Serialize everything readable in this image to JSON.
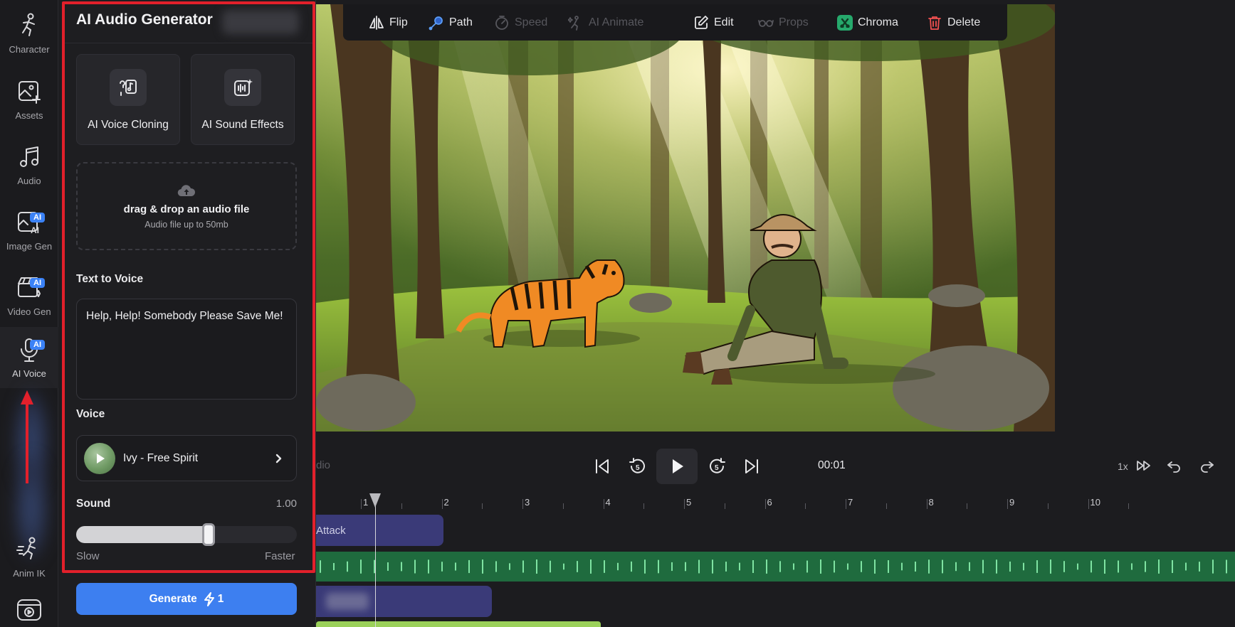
{
  "rail": {
    "items": [
      {
        "label": "Character",
        "icon": "character-icon"
      },
      {
        "label": "Assets",
        "icon": "image-plus-icon"
      },
      {
        "label": "Audio",
        "icon": "music-note-icon"
      },
      {
        "label": "Image Gen",
        "icon": "image-ai-icon",
        "badge": "AI"
      },
      {
        "label": "Video Gen",
        "icon": "clapperboard-icon",
        "badge": "AI"
      },
      {
        "label": "AI Voice",
        "icon": "microphone-icon",
        "badge": "AI"
      },
      {
        "label": "Anim IK",
        "icon": "running-figure-icon"
      }
    ],
    "extra_icon": "video-play-icon"
  },
  "panel": {
    "title": "AI Audio Generator",
    "cards": [
      {
        "label": "AI Voice Cloning",
        "icon": "voice-clone-icon"
      },
      {
        "label": "AI Sound Effects",
        "icon": "sound-effects-icon"
      }
    ],
    "dropzone": {
      "title": "drag & drop an audio file",
      "subtitle": "Audio file up to 50mb"
    },
    "tts": {
      "label": "Text to Voice",
      "value": "Help, Help! Somebody Please Save Me!"
    },
    "voice": {
      "label": "Voice",
      "name": "Ivy - Free Spirit"
    },
    "sound": {
      "label": "Sound",
      "value_text": "1.00",
      "level": 0.6,
      "min_label": "Slow",
      "max_label": "Faster"
    },
    "generate": {
      "label": "Generate",
      "count": "1"
    }
  },
  "toolbar": {
    "items": [
      {
        "label": "Flip",
        "icon": "flip-icon",
        "enabled": true
      },
      {
        "label": "Path",
        "icon": "path-icon",
        "enabled": true
      },
      {
        "label": "Speed",
        "icon": "speed-icon",
        "enabled": false
      },
      {
        "label": "AI Animate",
        "icon": "ai-animate-icon",
        "enabled": false
      },
      {
        "label": "Edit",
        "icon": "edit-icon",
        "enabled": true
      },
      {
        "label": "Props",
        "icon": "glasses-icon",
        "enabled": false
      },
      {
        "label": "Chroma",
        "icon": "chroma-icon",
        "enabled": true
      },
      {
        "label": "Delete",
        "icon": "trash-icon",
        "enabled": true
      }
    ]
  },
  "playback": {
    "time": "00:01",
    "speed": "1x",
    "ghost_label": "dio",
    "skip_back_seconds": "5",
    "skip_forward_seconds": "5"
  },
  "timeline": {
    "ticks": [
      "1",
      "2",
      "3",
      "4",
      "5",
      "6",
      "7",
      "8",
      "9",
      "10"
    ],
    "tracks": [
      {
        "label": "Attack"
      }
    ]
  },
  "colors": {
    "accent": "#3d7ff0",
    "highlight_border": "#e2202b",
    "ai_badge": "#3b82f6",
    "audio_track": "#1f6b3e",
    "clip_track": "#3a3a78",
    "delete": "#f05050",
    "chroma": "#26a96c"
  }
}
